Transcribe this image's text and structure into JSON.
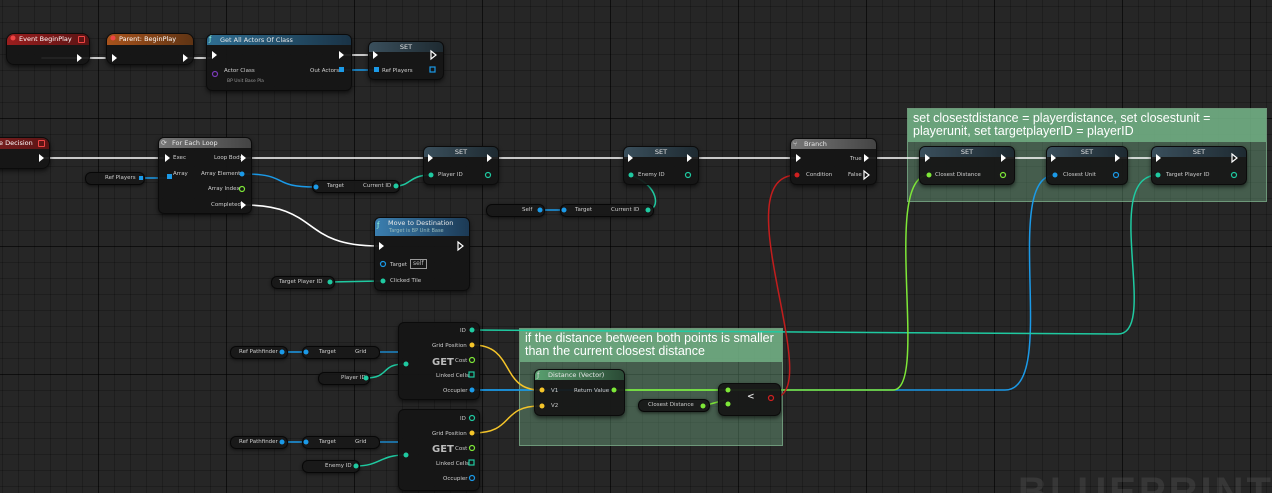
{
  "app": "Unreal Engine Blueprint Editor",
  "watermark": "BLUEPRINT",
  "comments": {
    "set_closest": "set closestdistance = playerdistance, set closestunit = playerunit, set targetplayerID = playerID",
    "distance_check": "if the distance between both points is smaller than the current closest distance"
  },
  "nodes": {
    "event_begin_play": "Event BeginPlay",
    "parent_begin_play": "Parent: BeginPlay",
    "get_all_actors": {
      "title": "Get All Actors Of Class",
      "actor_class_label": "Actor Class",
      "actor_class_value": "BP Unit Base Pla",
      "out_actors": "Out Actors"
    },
    "set_ref_players": {
      "title": "SET",
      "pin": "Ref Players"
    },
    "decision_event": "e Decision",
    "for_each_loop": {
      "title": "For Each Loop",
      "exec": "Exec",
      "array": "Array",
      "loop_body": "Loop Body",
      "array_element": "Array Element",
      "array_index": "Array Index",
      "completed": "Completed"
    },
    "ref_players_getter": "Ref Players",
    "target_current_id_1": {
      "target": "Target",
      "current_id": "Current ID"
    },
    "set_player_id": {
      "title": "SET",
      "pin": "Player ID"
    },
    "set_enemy_id": {
      "title": "SET",
      "pin": "Enemy ID"
    },
    "self_node": "Self",
    "target_current_id_2": {
      "target": "Target",
      "current_id": "Current ID"
    },
    "move_to_destination": {
      "title": "Move to Destination",
      "subtitle": "Target is BP Unit Base",
      "target": "Target",
      "target_value": "self",
      "clicked_tile": "Clicked Tile"
    },
    "target_player_id_getter": "Target Player ID",
    "branch": {
      "title": "Branch",
      "condition": "Condition",
      "true": "True",
      "false": "False"
    },
    "set_closest_distance": {
      "title": "SET",
      "pin": "Closest Distance"
    },
    "set_closest_unit": {
      "title": "SET",
      "pin": "Closest Unit"
    },
    "set_target_player_id": {
      "title": "SET",
      "pin": "Target Player ID"
    },
    "ref_pathfinder_1": "Ref Pathfinder",
    "target_grid_1": {
      "target": "Target",
      "grid": "Grid"
    },
    "player_id_getter": "Player ID",
    "ref_pathfinder_2": "Ref Pathfinder",
    "target_grid_2": {
      "target": "Target",
      "grid": "Grid"
    },
    "enemy_id_getter": "Enemy ID",
    "get_node_1": {
      "get": "GET",
      "id": "ID",
      "grid_position": "Grid Position",
      "cost": "Cost",
      "linked_cells": "Linked Cells",
      "occupier": "Occupier"
    },
    "get_node_2": {
      "get": "GET",
      "id": "ID",
      "grid_position": "Grid Position",
      "cost": "Cost",
      "linked_cells": "Linked Cells",
      "occupier": "Occupier"
    },
    "distance_vector": {
      "title": "Distance (Vector)",
      "v1": "V1",
      "v2": "V2",
      "return_value": "Return Value"
    },
    "closest_distance_getter": "Closest Distance",
    "less_than": "<"
  },
  "colors": {
    "exec": "#ffffff",
    "object": "#1b9ae8",
    "struct": "#1fcaa1",
    "vector": "#f5c52a",
    "float": "#7ee838",
    "bool": "#d02020",
    "class": "#7a3ab8"
  }
}
